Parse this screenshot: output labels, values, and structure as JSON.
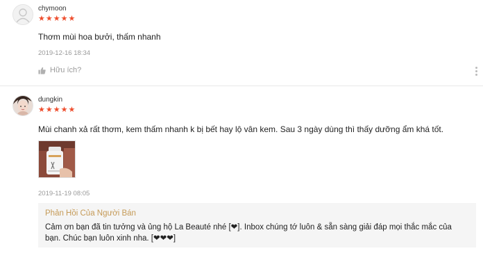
{
  "reviews": [
    {
      "username": "chymoon",
      "stars": "★★★★★",
      "content": "Thơm mùi hoa bưởi, thấm nhanh",
      "timestamp": "2019-12-16 18:34",
      "helpful_label": "Hữu ích?"
    },
    {
      "username": "dungkin",
      "stars": "★★★★★",
      "content": "Mùi chanh xả rất thơm,  kem thấm nhanh k bị bết hay lộ vân kem. Sau 3 ngày dùng thì thấy dưỡng ẩm khá tốt.",
      "timestamp": "2019-11-19 08:05",
      "seller_reply": {
        "title": "Phản Hồi Của Người Bán",
        "text": "Cảm ơn bạn đã tin tưởng và ủng hộ La Beauté nhé [❤]. Inbox chúng tớ luôn & sẵn sàng giải đáp mọi thắc mắc của bạn. Chúc bạn luôn xinh nha. [❤❤❤]"
      }
    }
  ],
  "colors": {
    "star": "#ee4d2d",
    "seller_title": "#c59a57",
    "seller_bg": "#f5f5f5"
  },
  "icons": {
    "avatar_default": "user-icon",
    "helpful": "thumbs-up-icon",
    "more": "more-vertical-icon"
  }
}
